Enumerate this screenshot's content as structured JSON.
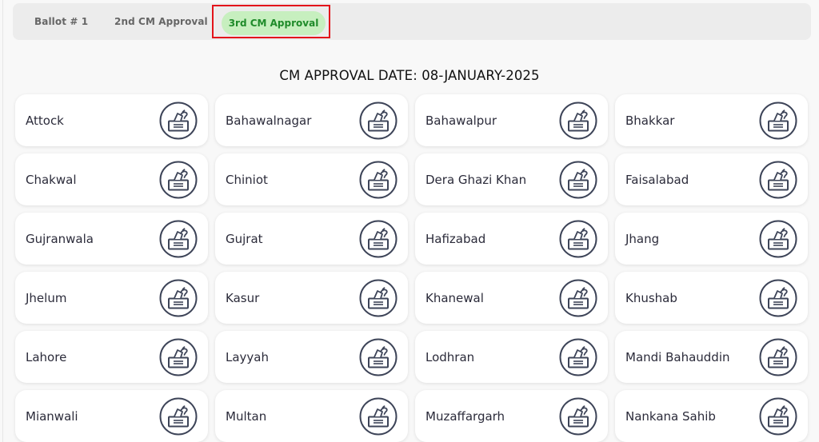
{
  "tabs": [
    {
      "label": "Ballot # 1",
      "active": false
    },
    {
      "label": "2nd CM Approval",
      "active": false
    },
    {
      "label": "3rd CM Approval",
      "active": true
    }
  ],
  "approval_date_text": "CM APPROVAL DATE: 08-JANUARY-2025",
  "colors": {
    "active_tab_bg": "#c7efbf",
    "active_tab_text": "#1f8b2a",
    "highlight_border": "#e3141b",
    "icon_stroke": "#3d4458"
  },
  "card_icon": "ballot-box-icon",
  "districts": [
    "Attock",
    "Bahawalnagar",
    "Bahawalpur",
    "Bhakkar",
    "Chakwal",
    "Chiniot",
    "Dera Ghazi Khan",
    "Faisalabad",
    "Gujranwala",
    "Gujrat",
    "Hafizabad",
    "Jhang",
    "Jhelum",
    "Kasur",
    "Khanewal",
    "Khushab",
    "Lahore",
    "Layyah",
    "Lodhran",
    "Mandi Bahauddin",
    "Mianwali",
    "Multan",
    "Muzaffargarh",
    "Nankana Sahib"
  ]
}
